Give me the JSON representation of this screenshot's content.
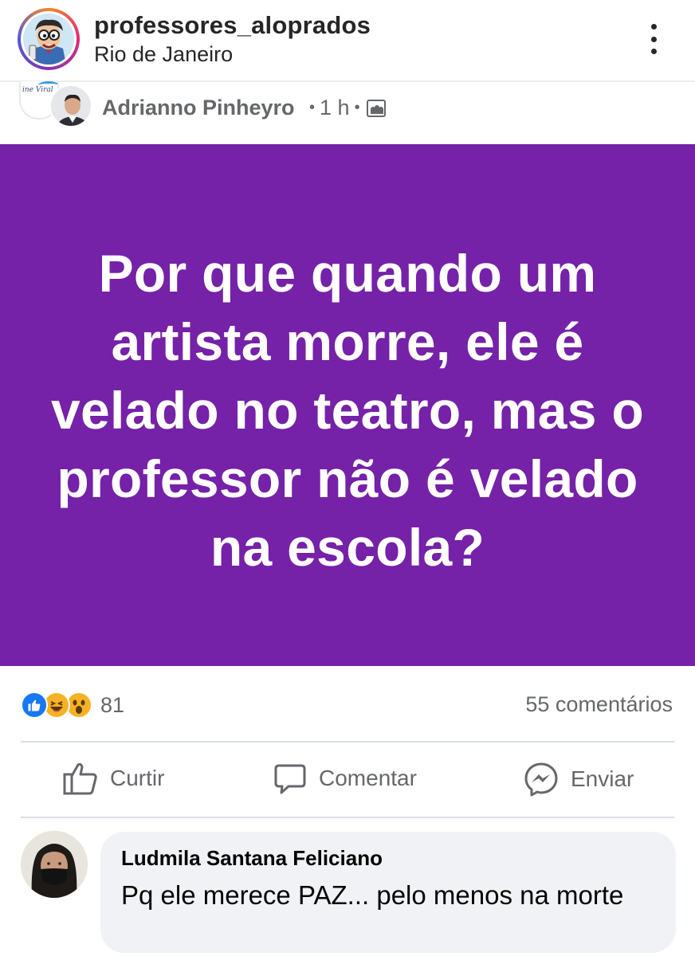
{
  "instagram": {
    "username": "professores_aloprados",
    "location": "Rio de Janeiro"
  },
  "post": {
    "page_thumb_text": "ine Viral",
    "author": "Adrianno Pinheyro",
    "time": "1 h",
    "separator": "•",
    "card_text": "Por que quando um artista morre, ele é velado no teatro, mas o professor não é velado na escola?",
    "card_color": "#7521a8",
    "reactions": {
      "icons": [
        "like-icon",
        "haha-icon",
        "wow-icon"
      ],
      "count": "81"
    },
    "comments_count": "55 comentários",
    "actions": {
      "like": "Curtir",
      "comment": "Comentar",
      "send": "Enviar"
    }
  },
  "comment": {
    "author": "Ludmila Santana Feliciano",
    "text": "Pq ele merece PAZ... pelo menos na morte"
  }
}
